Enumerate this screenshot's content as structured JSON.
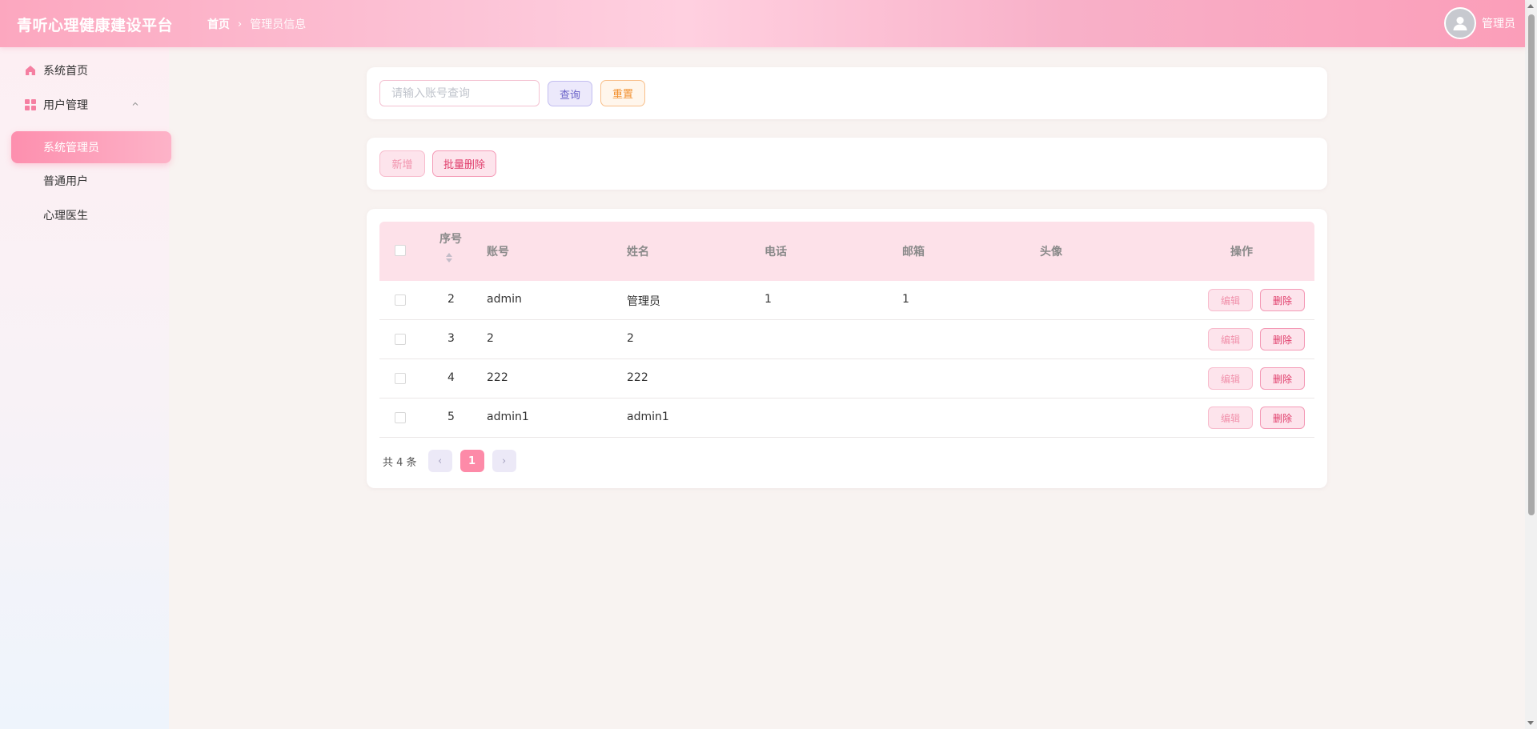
{
  "header": {
    "app_title": "青听心理健康建设平台",
    "breadcrumb": {
      "home": "首页",
      "current": "管理员信息"
    },
    "username": "管理员"
  },
  "sidebar": {
    "items": [
      {
        "label": "系统首页",
        "icon": "home-icon"
      },
      {
        "label": "用户管理",
        "icon": "grid-icon",
        "expanded": true
      }
    ],
    "sub_items": [
      {
        "label": "系统管理员",
        "active": true
      },
      {
        "label": "普通用户",
        "active": false
      },
      {
        "label": "心理医生",
        "active": false
      }
    ]
  },
  "search": {
    "placeholder": "请输入账号查询",
    "query_label": "查询",
    "reset_label": "重置"
  },
  "actions": {
    "add_label": "新增",
    "batch_delete_label": "批量删除"
  },
  "table": {
    "headers": {
      "index": "序号",
      "account": "账号",
      "name": "姓名",
      "phone": "电话",
      "email": "邮箱",
      "avatar": "头像",
      "ops": "操作"
    },
    "edit_label": "编辑",
    "delete_label": "删除",
    "rows": [
      {
        "id": "2",
        "account": "admin",
        "name": "管理员",
        "phone": "1",
        "email": "1"
      },
      {
        "id": "3",
        "account": "2",
        "name": "2",
        "phone": "",
        "email": ""
      },
      {
        "id": "4",
        "account": "222",
        "name": "222",
        "phone": "",
        "email": ""
      },
      {
        "id": "5",
        "account": "admin1",
        "name": "admin1",
        "phone": "",
        "email": ""
      }
    ]
  },
  "pagination": {
    "total_text": "共 4 条",
    "current_page": "1",
    "prev": "‹",
    "next": "›"
  },
  "colors": {
    "accent": "#fd8aa8",
    "header_gradient": "#fcc3d6",
    "danger_text": "#e03d6b",
    "query_text": "#6a62c8",
    "reset_text": "#f28f2c"
  }
}
